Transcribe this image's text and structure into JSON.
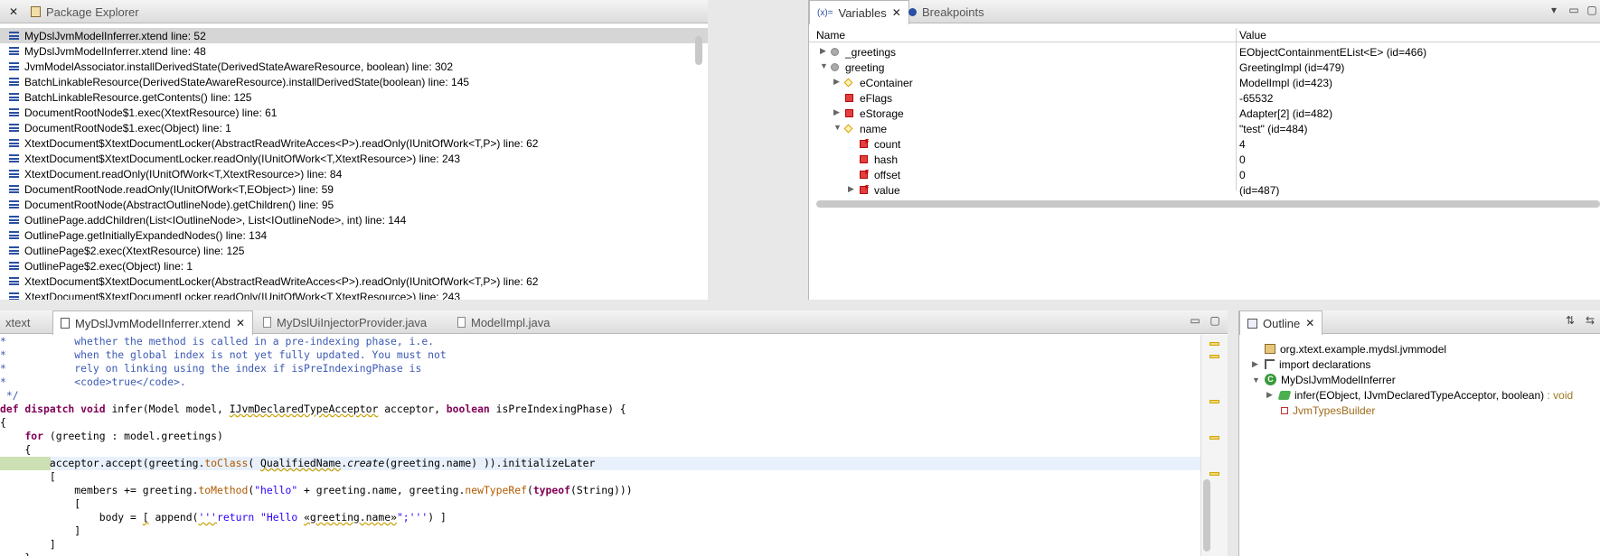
{
  "stack_panel": {
    "tab_label": "Package Explorer",
    "frames": [
      "MyDslJvmModelInferrer.xtend line: 52",
      "MyDslJvmModelInferrer.xtend line: 48",
      "JvmModelAssociator.installDerivedState(DerivedStateAwareResource, boolean) line: 302",
      "BatchLinkableResource(DerivedStateAwareResource).installDerivedState(boolean) line: 145",
      "BatchLinkableResource.getContents() line: 125",
      "DocumentRootNode$1.exec(XtextResource) line: 61",
      "DocumentRootNode$1.exec(Object) line: 1",
      "XtextDocument$XtextDocumentLocker(AbstractReadWriteAcces<P>).readOnly(IUnitOfWork<T,P>) line: 62",
      "XtextDocument$XtextDocumentLocker.readOnly(IUnitOfWork<T,XtextResource>) line: 243",
      "XtextDocument.readOnly(IUnitOfWork<T,XtextResource>) line: 84",
      "DocumentRootNode.readOnly(IUnitOfWork<T,EObject>) line: 59",
      "DocumentRootNode(AbstractOutlineNode).getChildren() line: 95",
      "OutlinePage.addChildren(List<IOutlineNode>, List<IOutlineNode>, int) line: 144",
      "OutlinePage.getInitiallyExpandedNodes() line: 134",
      "OutlinePage$2.exec(XtextResource) line: 125",
      "OutlinePage$2.exec(Object) line: 1",
      "XtextDocument$XtextDocumentLocker(AbstractReadWriteAcces<P>).readOnly(IUnitOfWork<T,P>) line: 62",
      "XtextDocument$XtextDocumentLocker.readOnly(IUnitOfWork<T,XtextResource>) line: 243"
    ]
  },
  "variables_panel": {
    "tab_variables": "Variables",
    "tab_variables_prefix": "(x)=",
    "tab_breakpoints": "Breakpoints",
    "col_name": "Name",
    "col_value": "Value",
    "rows": [
      {
        "name": "_greetings",
        "value": "EObjectContainmentEList<E>  (id=466)"
      },
      {
        "name": "greeting",
        "value": "GreetingImpl  (id=479)"
      },
      {
        "name": "eContainer",
        "value": "ModelImpl  (id=423)"
      },
      {
        "name": "eFlags",
        "value": "-65532"
      },
      {
        "name": "eStorage",
        "value": "Adapter[2]  (id=482)"
      },
      {
        "name": "name",
        "value": "\"test\" (id=484)"
      },
      {
        "name": "count",
        "value": "4"
      },
      {
        "name": "hash",
        "value": "0"
      },
      {
        "name": "offset",
        "value": "0"
      },
      {
        "name": "value",
        "value": "(id=487)"
      }
    ]
  },
  "editor": {
    "tab_partial": "xtext",
    "tab_active": "MyDslJvmModelInferrer.xtend",
    "tab_2": "MyDslUiInjectorProvider.java",
    "tab_3": "ModelImpl.java"
  },
  "outline": {
    "tab_label": "Outline",
    "package": "org.xtext.example.mydsl.jvmmodel",
    "imports": "import declarations",
    "class": "MyDslJvmModelInferrer",
    "method": "infer(EObject, IJvmDeclaredTypeAcceptor, boolean)",
    "method_return": " : void",
    "field": "JvmTypesBuilder"
  }
}
